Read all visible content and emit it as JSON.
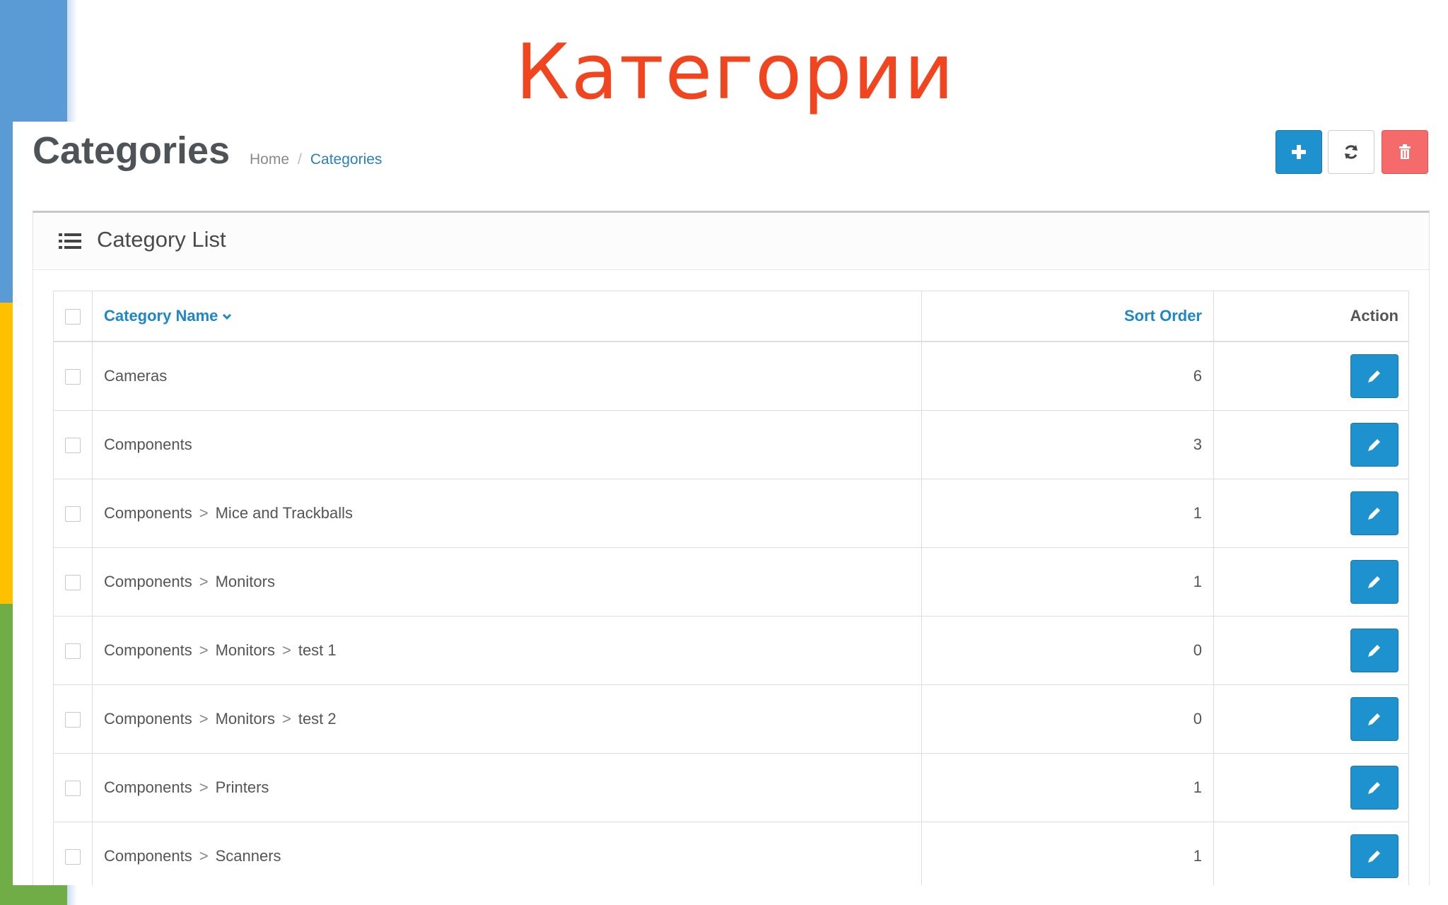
{
  "slide": {
    "title": "Категории"
  },
  "header": {
    "title": "Categories",
    "breadcrumb": {
      "home": "Home",
      "separator": "/",
      "current": "Categories"
    },
    "buttons": [
      "add",
      "refresh",
      "delete"
    ]
  },
  "panel": {
    "title": "Category List"
  },
  "table": {
    "columns": {
      "name": "Category Name",
      "sort": "Sort Order",
      "action": "Action"
    },
    "rows": [
      {
        "path": [
          "Cameras"
        ],
        "sort": "6"
      },
      {
        "path": [
          "Components"
        ],
        "sort": "3"
      },
      {
        "path": [
          "Components",
          "Mice and Trackballs"
        ],
        "sort": "1"
      },
      {
        "path": [
          "Components",
          "Monitors"
        ],
        "sort": "1"
      },
      {
        "path": [
          "Components",
          "Monitors",
          "test 1"
        ],
        "sort": "0"
      },
      {
        "path": [
          "Components",
          "Monitors",
          "test 2"
        ],
        "sort": "0"
      },
      {
        "path": [
          "Components",
          "Printers"
        ],
        "sort": "1"
      },
      {
        "path": [
          "Components",
          "Scanners"
        ],
        "sort": "1"
      }
    ],
    "path_separator": ">"
  },
  "colors": {
    "primary": "#1e91cf",
    "danger": "#f56b6b",
    "slide_title": "#f0451e",
    "link": "#1e86c9",
    "stripe_blue": "#5b9bd5",
    "stripe_yellow": "#ffc000",
    "stripe_green": "#70ad47"
  },
  "icons": {
    "add": "plus-icon",
    "refresh": "refresh-icon",
    "delete": "trash-icon",
    "panel": "list-icon",
    "edit": "pencil-icon",
    "sort_indicator": "chevron-down-icon"
  }
}
